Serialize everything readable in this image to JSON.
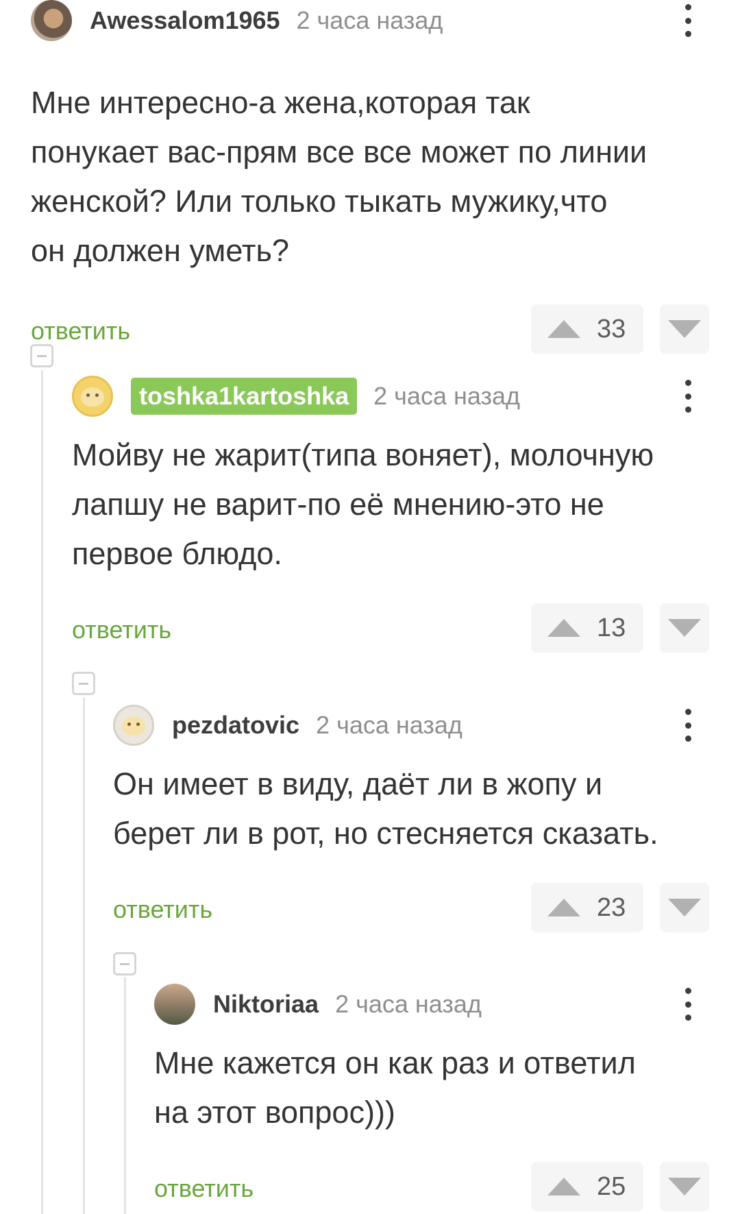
{
  "comments": [
    {
      "username": "Awessalom1965",
      "time": "2 часа назад",
      "lines": [
        "Мне интересно-а жена,которая так",
        "понукает вас-прям все все может по линии",
        "женской? Или только тыкать мужику,что",
        "он должен уметь?"
      ],
      "reply_label": "ответить",
      "score": "33"
    },
    {
      "username": "toshka1kartoshka",
      "time": "2 часа назад",
      "lines": [
        "Мойву не жарит(типа воняет), молочную",
        "лапшу не варит-по её мнению-это не",
        "первое блюдо."
      ],
      "reply_label": "ответить",
      "score": "13"
    },
    {
      "username": "pezdatovic",
      "time": "2 часа назад",
      "lines": [
        "Он имеет в виду, даёт ли в жопу и",
        "берет ли в рот, но стесняется сказать."
      ],
      "reply_label": "ответить",
      "score": "23"
    },
    {
      "username": "Niktoriaa",
      "time": "2 часа назад",
      "lines": [
        "Мне кажется он как раз и ответил",
        "на этот вопрос)))"
      ],
      "reply_label": "ответить",
      "score": "25"
    }
  ],
  "colors": {
    "reply_green": "#68a73c",
    "badge_green": "#8ac858",
    "vote_bg": "#f5f5f5"
  },
  "icons": [
    "more-vertical-icon",
    "upvote-arrow-icon",
    "downvote-arrow-icon",
    "collapse-thread-icon"
  ]
}
